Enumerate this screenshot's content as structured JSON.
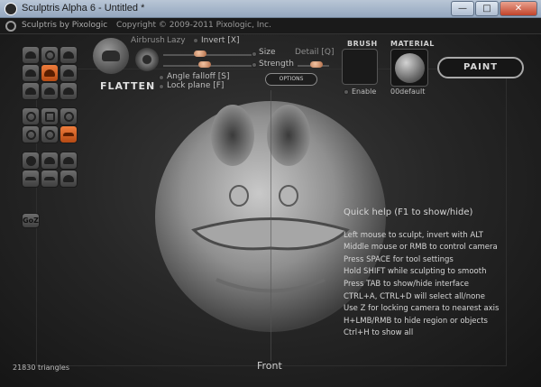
{
  "window": {
    "title": "Sculptris Alpha 6 - Untitled *",
    "minimize": "—",
    "maximize": "□",
    "close": "✕"
  },
  "topbar": {
    "brand": "Sculptris by Pixologic",
    "copyright": "Copyright © 2009-2011 Pixologic, Inc."
  },
  "brush": {
    "name": "FLATTEN",
    "airbrush_label": "Airbrush",
    "lazy_label": "Lazy",
    "invert_label": "Invert [X]",
    "size_label": "Size",
    "strength_label": "Strength",
    "detail_label": "Detail [Q]",
    "angle_falloff_label": "Angle falloff [S]",
    "lock_plane_label": "Lock plane [F]",
    "options_label": "OPTIONS"
  },
  "panels": {
    "brush_title": "BRUSH",
    "brush_enable": "Enable",
    "material_title": "MATERIAL",
    "material_name": "00default",
    "paint_label": "PAINT"
  },
  "tools": {
    "goz_label": "GoZ"
  },
  "help": {
    "title": "Quick help (F1 to show/hide)",
    "lines": [
      "Left mouse to sculpt, invert with ALT",
      "Middle mouse or RMB to control camera",
      "Press SPACE for tool settings",
      "Hold SHIFT while sculpting to smooth",
      "Press TAB to show/hide interface",
      "CTRL+A, CTRL+D will select all/none",
      "Use Z for locking camera to nearest axis",
      "H+LMB/RMB to hide region or objects",
      "Ctrl+H to show all"
    ]
  },
  "status": {
    "triangles": "21830 triangles",
    "view": "Front"
  },
  "colors": {
    "accent": "#e06a2c",
    "background": "#262626"
  }
}
